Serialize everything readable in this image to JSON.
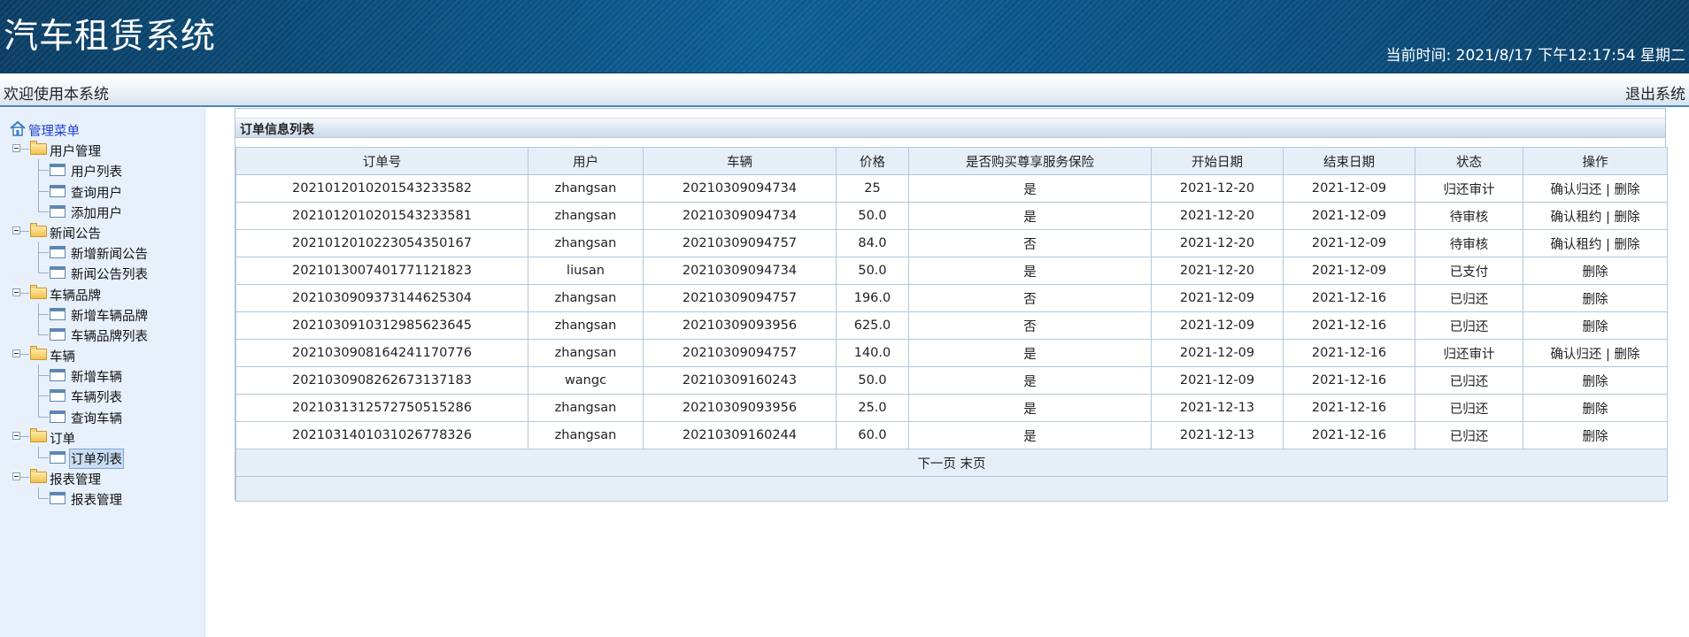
{
  "header": {
    "title": "汽车租赁系统",
    "clock_label": "当前时间:",
    "clock_value": "2021/8/17 下午12:17:54 星期二"
  },
  "welcome_bar": {
    "welcome": "欢迎使用本系统",
    "logout": "退出系统"
  },
  "sidebar": {
    "root": "管理菜单",
    "groups": [
      {
        "label": "用户管理",
        "items": [
          "用户列表",
          "查询用户",
          "添加用户"
        ]
      },
      {
        "label": "新闻公告",
        "items": [
          "新增新闻公告",
          "新闻公告列表"
        ]
      },
      {
        "label": "车辆品牌",
        "items": [
          "新增车辆品牌",
          "车辆品牌列表"
        ]
      },
      {
        "label": "车辆",
        "items": [
          "新增车辆",
          "车辆列表",
          "查询车辆"
        ]
      },
      {
        "label": "订单",
        "items": [
          "订单列表"
        ]
      },
      {
        "label": "报表管理",
        "items": [
          "报表管理"
        ]
      }
    ],
    "selected": "订单列表"
  },
  "panel": {
    "title": "订单信息列表",
    "columns": [
      "订单号",
      "用户",
      "车辆",
      "价格",
      "是否购买尊享服务保险",
      "开始日期",
      "结束日期",
      "状态",
      "操作"
    ],
    "rows": [
      {
        "order_no": "20210120102015432335 82",
        "user": "zhangsan",
        "car": "20210309094734",
        "price": "25",
        "insurance": "是",
        "start": "2021-12-20",
        "end": "2021-12-09",
        "status": "归还审计",
        "actions": [
          "确认归还",
          "删除"
        ]
      },
      {
        "order_no": "20210120102015432335 81",
        "user": "zhangsan",
        "car": "20210309094734",
        "price": "50.0",
        "insurance": "是",
        "start": "2021-12-20",
        "end": "2021-12-09",
        "status": "待审核",
        "actions": [
          "确认租约",
          "删除"
        ]
      },
      {
        "order_no": "20210120102230543501 67",
        "user": "zhangsan",
        "car": "20210309094757",
        "price": "84.0",
        "insurance": "否",
        "start": "2021-12-20",
        "end": "2021-12-09",
        "status": "待审核",
        "actions": [
          "确认租约",
          "删除"
        ]
      },
      {
        "order_no": "20210130074017711218 23",
        "user": "liusan",
        "car": "20210309094734",
        "price": "50.0",
        "insurance": "是",
        "start": "2021-12-20",
        "end": "2021-12-09",
        "status": "已支付",
        "actions": [
          "删除"
        ]
      },
      {
        "order_no": "20210309093731446253 04",
        "user": "zhangsan",
        "car": "20210309094757",
        "price": "196.0",
        "insurance": "否",
        "start": "2021-12-09",
        "end": "2021-12-16",
        "status": "已归还",
        "actions": [
          "删除"
        ]
      },
      {
        "order_no": "20210309103129856236 45",
        "user": "zhangsan",
        "car": "20210309093956",
        "price": "625.0",
        "insurance": "否",
        "start": "2021-12-09",
        "end": "2021-12-16",
        "status": "已归还",
        "actions": [
          "删除"
        ]
      },
      {
        "order_no": "20210309081642411707 76",
        "user": "zhangsan",
        "car": "20210309094757",
        "price": "140.0",
        "insurance": "是",
        "start": "2021-12-09",
        "end": "2021-12-16",
        "status": "归还审计",
        "actions": [
          "确认归还",
          "删除"
        ]
      },
      {
        "order_no": "20210309082626731371 83",
        "user": "wangc",
        "car": "20210309160243",
        "price": "50.0",
        "insurance": "是",
        "start": "2021-12-09",
        "end": "2021-12-16",
        "status": "已归还",
        "actions": [
          "删除"
        ]
      },
      {
        "order_no": "20210313125727505152 86",
        "user": "zhangsan",
        "car": "20210309093956",
        "price": "25.0",
        "insurance": "是",
        "start": "2021-12-13",
        "end": "2021-12-16",
        "status": "已归还",
        "actions": [
          "删除"
        ]
      },
      {
        "order_no": "20210314010310267783 26",
        "user": "zhangsan",
        "car": "20210309160244",
        "price": "60.0",
        "insurance": "是",
        "start": "2021-12-13",
        "end": "2021-12-16",
        "status": "已归还",
        "actions": [
          "删除"
        ]
      }
    ],
    "pager": {
      "next": "下一页",
      "last": "末页"
    }
  }
}
